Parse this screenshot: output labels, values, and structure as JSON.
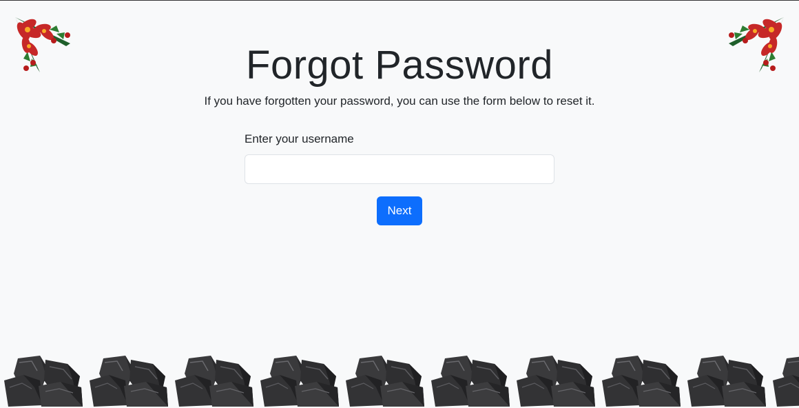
{
  "page": {
    "title": "Forgot Password",
    "subtitle": "If you have forgotten your password, you can use the form below to reset it."
  },
  "form": {
    "username_label": "Enter your username",
    "username_value": "",
    "username_placeholder": "",
    "next_label": "Next"
  },
  "decorations": {
    "corner_icon": "poinsettia-holly-icon",
    "footer_icon": "coal-pile-icon",
    "footer_count": 10
  },
  "colors": {
    "background": "#f8f9fa",
    "primary": "#0d6efd",
    "text": "#212529"
  }
}
